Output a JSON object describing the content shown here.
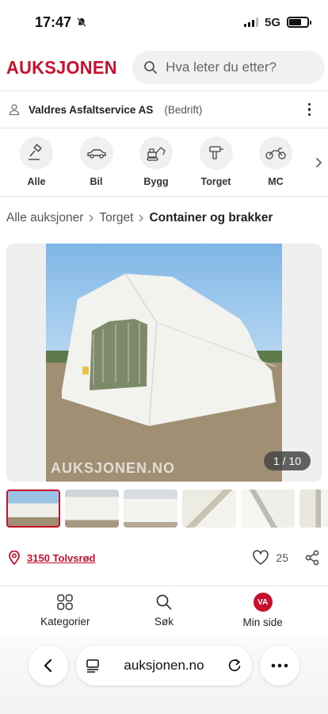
{
  "status": {
    "time": "17:47",
    "network": "5G"
  },
  "header": {
    "logo": "AUKSJONEN",
    "search_placeholder": "Hva leter du etter?"
  },
  "seller": {
    "name": "Valdres Asfaltservice AS",
    "type": "(Bedrift)"
  },
  "categories": [
    {
      "label": "Alle",
      "icon": "gavel-icon"
    },
    {
      "label": "Bil",
      "icon": "car-icon"
    },
    {
      "label": "Bygg",
      "icon": "excavator-icon"
    },
    {
      "label": "Torget",
      "icon": "drill-icon"
    },
    {
      "label": "MC",
      "icon": "motorcycle-icon"
    }
  ],
  "breadcrumb": {
    "items": [
      "Alle auksjoner",
      "Torget"
    ],
    "current": "Container og brakker"
  },
  "gallery": {
    "counter": "1 / 10",
    "watermark": "AUKSJONEN.NO"
  },
  "listing": {
    "location": "3150 Tolvsrød",
    "likes": "25"
  },
  "bottom_nav": [
    {
      "label": "Kategorier",
      "icon": "grid-icon"
    },
    {
      "label": "Søk",
      "icon": "search-icon"
    },
    {
      "label": "Min side",
      "icon": "avatar-icon",
      "avatar_initials": "VA"
    }
  ],
  "browser": {
    "url": "auksjonen.no"
  },
  "colors": {
    "brand": "#c8102e",
    "text": "#222222",
    "muted": "#555555"
  }
}
